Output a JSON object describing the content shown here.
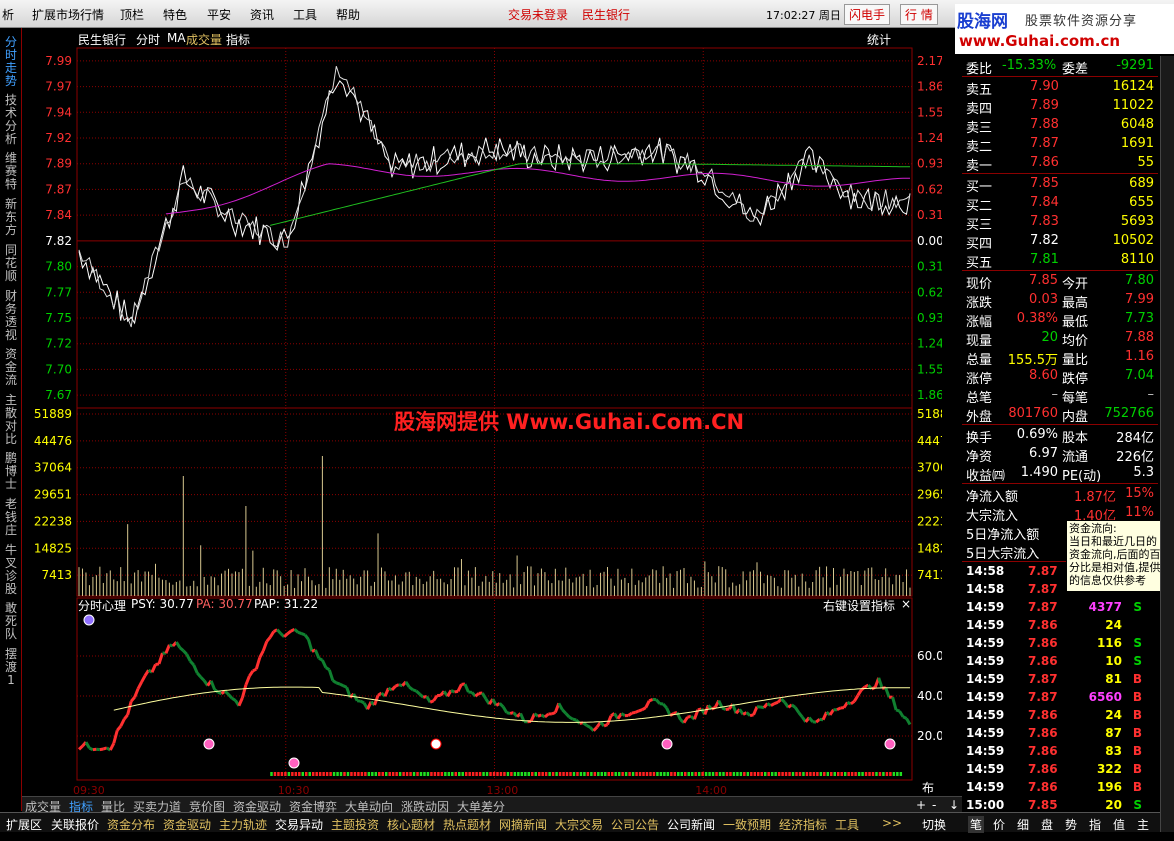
{
  "menu": {
    "items": [
      "析",
      "扩展市场行情",
      "顶栏",
      "特色",
      "平安",
      "资讯",
      "工具",
      "帮助"
    ],
    "trade_status": "交易未登录",
    "stock_name": "民生银行",
    "time": "17:02:27 周日",
    "flash_button": "闪电手",
    "quote_button": "行 情"
  },
  "logo": {
    "brand": "股海网",
    "slogan": "股票软件资源分享",
    "url": "www.Guhai.com.cn"
  },
  "left_tabs": [
    "分时走势",
    "技术分析",
    "维赛特",
    "新东方",
    "同花顺",
    "财务透视",
    "资金流",
    "主散对比",
    "鹏博士",
    "老钱庄",
    "牛叉诊股",
    "敢死队",
    "摆渡1"
  ],
  "chart": {
    "header": {
      "stock": "民生银行",
      "mode": "分时",
      "ma": "MA",
      "ma2": "成交量",
      "indicator": "指标",
      "stats": "统计"
    },
    "price_labels": [
      "7.99",
      "7.97",
      "7.94",
      "7.92",
      "7.89",
      "7.87",
      "7.84",
      "7.82",
      "7.80",
      "7.77",
      "7.75",
      "7.72",
      "7.70",
      "7.67"
    ],
    "pct_labels": [
      "2.17%",
      "1.86%",
      "1.55%",
      "1.24%",
      "0.93%",
      "0.62%",
      "0.31%",
      "0.00%",
      "0.31%",
      "0.62%",
      "0.93%",
      "1.24%",
      "1.55%",
      "1.86%"
    ],
    "vol_labels": [
      "51889",
      "44476",
      "37064",
      "29651",
      "22238",
      "14825",
      "7413"
    ],
    "watermark": "股海网提供 Www.Guhai.Com.CN",
    "indicator_header": {
      "name": "分时心理",
      "psy": "PSY: 30.77",
      "pa": "PA: 30.77",
      "pap": "PAP: 31.22",
      "setting": "右键设置指标"
    },
    "ind_labels": [
      "60.00",
      "40.00",
      "20.00"
    ],
    "time_labels": [
      "09:30",
      "10:30",
      "13:00",
      "14:00"
    ],
    "layout_button": "布局"
  },
  "quote": {
    "weibi": {
      "label": "委比",
      "value": "-15.33%",
      "label2": "委差",
      "value2": "-9291"
    },
    "asks": [
      {
        "label": "卖五",
        "price": "7.90",
        "vol": "16124"
      },
      {
        "label": "卖四",
        "price": "7.89",
        "vol": "11022"
      },
      {
        "label": "卖三",
        "price": "7.88",
        "vol": "6048"
      },
      {
        "label": "卖二",
        "price": "7.87",
        "vol": "1691"
      },
      {
        "label": "卖一",
        "price": "7.86",
        "vol": "55"
      }
    ],
    "bids": [
      {
        "label": "买一",
        "price": "7.85",
        "vol": "689"
      },
      {
        "label": "买二",
        "price": "7.84",
        "vol": "655"
      },
      {
        "label": "买三",
        "price": "7.83",
        "vol": "5693"
      },
      {
        "label": "买四",
        "price": "7.82",
        "vol": "10502"
      },
      {
        "label": "买五",
        "price": "7.81",
        "vol": "8110"
      }
    ],
    "stats": [
      {
        "l1": "现价",
        "v1": "7.85",
        "l2": "今开",
        "v2": "7.80"
      },
      {
        "l1": "涨跌",
        "v1": "0.03",
        "l2": "最高",
        "v2": "7.99"
      },
      {
        "l1": "涨幅",
        "v1": "0.38%",
        "l2": "最低",
        "v2": "7.73"
      },
      {
        "l1": "现量",
        "v1": "20",
        "l2": "均价",
        "v2": "7.88"
      },
      {
        "l1": "总量",
        "v1": "155.5万",
        "l2": "量比",
        "v2": "1.16"
      },
      {
        "l1": "涨停",
        "v1": "8.60",
        "l2": "跌停",
        "v2": "7.04"
      },
      {
        "l1": "总笔",
        "v1": "–",
        "l2": "每笔",
        "v2": "–"
      },
      {
        "l1": "外盘",
        "v1": "801760",
        "l2": "内盘",
        "v2": "752766"
      }
    ],
    "fin": [
      {
        "l1": "换手",
        "v1": "0.69%",
        "l2": "股本",
        "v2": "284亿"
      },
      {
        "l1": "净资",
        "v1": "6.97",
        "l2": "流通",
        "v2": "226亿"
      },
      {
        "l1": "收益㈣",
        "v1": "1.490",
        "l2": "PE(动)",
        "v2": "5.3"
      }
    ],
    "flow": [
      {
        "label": "净流入额",
        "value": "1.87亿",
        "pct": "15%"
      },
      {
        "label": "大宗流入",
        "value": "1.40亿",
        "pct": "11%"
      },
      {
        "label": "5日净流入额"
      },
      {
        "label": "5日大宗流入"
      }
    ],
    "tooltip": {
      "title": "资金流向:",
      "text": "当日和最近几日的资金流向,后面的百分比是相对值,提供的信息仅供参考"
    },
    "ticks": [
      {
        "t": "14:58",
        "p": "7.87",
        "v": "",
        "d": ""
      },
      {
        "t": "14:58",
        "p": "7.87",
        "v": "",
        "d": ""
      },
      {
        "t": "14:59",
        "p": "7.87",
        "v": "4377",
        "d": "S"
      },
      {
        "t": "14:59",
        "p": "7.86",
        "v": "24",
        "d": ""
      },
      {
        "t": "14:59",
        "p": "7.86",
        "v": "116",
        "d": "S"
      },
      {
        "t": "14:59",
        "p": "7.86",
        "v": "10",
        "d": "S"
      },
      {
        "t": "14:59",
        "p": "7.87",
        "v": "81",
        "d": "B"
      },
      {
        "t": "14:59",
        "p": "7.87",
        "v": "6560",
        "d": "B"
      },
      {
        "t": "14:59",
        "p": "7.86",
        "v": "24",
        "d": "B"
      },
      {
        "t": "14:59",
        "p": "7.86",
        "v": "87",
        "d": "B"
      },
      {
        "t": "14:59",
        "p": "7.86",
        "v": "83",
        "d": "B"
      },
      {
        "t": "14:59",
        "p": "7.86",
        "v": "322",
        "d": "B"
      },
      {
        "t": "14:59",
        "p": "7.86",
        "v": "196",
        "d": "B"
      },
      {
        "t": "15:00",
        "p": "7.85",
        "v": "20",
        "d": "S"
      }
    ]
  },
  "bottom_tabs": [
    "成交量",
    "指标",
    "量比",
    "买卖力道",
    "竞价图",
    "资金驱动",
    "资金博弈",
    "大单动向",
    "涨跌动因",
    "大单差分"
  ],
  "bottom_controls": [
    "+",
    "-",
    "↓"
  ],
  "status_tabs": [
    "扩展区",
    "关联报价",
    "资金分布",
    "资金驱动",
    "主力轨迹",
    "交易异动",
    "主题投资",
    "核心题材",
    "热点题材",
    "网摘新闻",
    "大宗交易",
    "公司公告",
    "公司新闻",
    "一致预期",
    "经济指标",
    "工具",
    ">>",
    "切换"
  ],
  "right_tabs": [
    "笔",
    "价",
    "细",
    "盘",
    "势",
    "指",
    "值",
    "主"
  ],
  "colors": {
    "up": "#ff3030",
    "down": "#00d000",
    "grid": "#8b0000",
    "price_line": "#ffffff",
    "avg_line": "#ffff00"
  }
}
